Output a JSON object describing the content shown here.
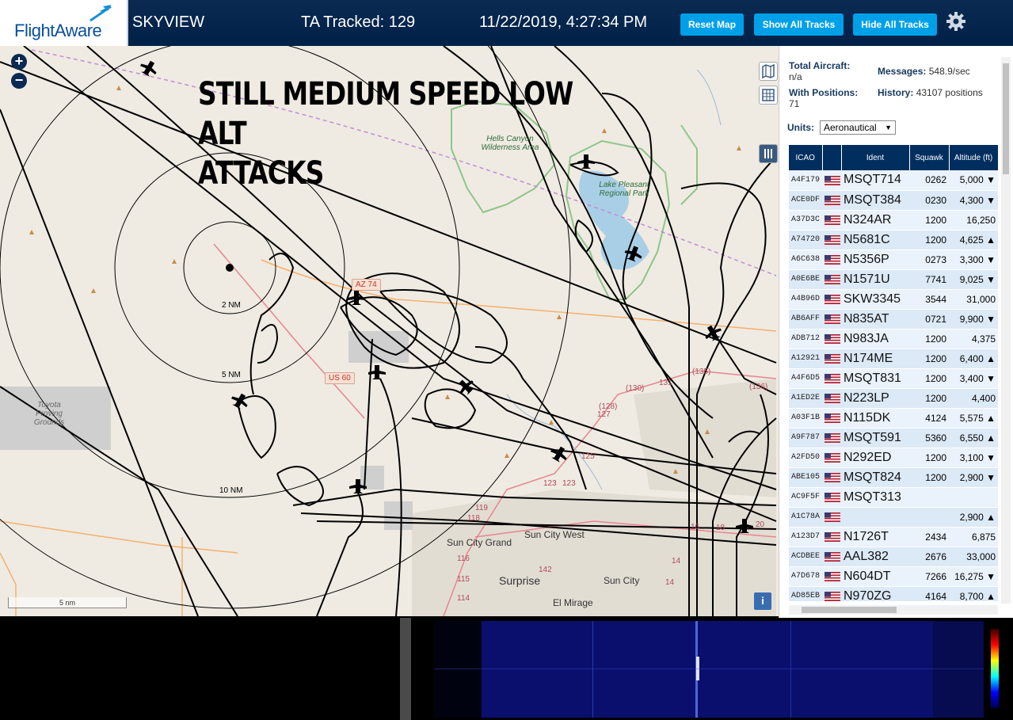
{
  "header": {
    "logo": "FlightAware",
    "app_title": "SKYVIEW",
    "ta_tracked": "TA Tracked: 129",
    "datetime": "11/22/2019, 4:27:34 PM",
    "buttons": {
      "reset": "Reset Map",
      "show_all": "Show All Tracks",
      "hide_all": "Hide All Tracks"
    },
    "settings_icon": "gear-icon",
    "accent_color": "#00a0e9"
  },
  "map": {
    "annotation_line1": "STILL MEDIUM SPEED LOW ALT",
    "annotation_line2": "ATTACKS",
    "ring_labels": [
      "2 NM",
      "5 NM",
      "10 NM"
    ],
    "towns": [
      "Sun City Grand",
      "Sun City West",
      "Surprise",
      "Sun City",
      "El Mirage"
    ],
    "park_labels": [
      "Hells Canyon Wilderness Area",
      "Lake Pleasant Regional Park",
      "Toyota Proving Grounds"
    ],
    "road_shields": [
      "AZ 74",
      "US 60"
    ],
    "route_numbers": [
      "(130)",
      "(128)",
      "127",
      "125",
      "123",
      "123",
      "119",
      "118",
      "116",
      "115",
      "114",
      "142",
      "(135)",
      "(136)",
      "131",
      "14",
      "18",
      "20",
      "16",
      "14"
    ],
    "scale_bar": "5 nm",
    "zoom_in": "+",
    "zoom_out": "−",
    "info": "i"
  },
  "panel": {
    "total_aircraft_label": "Total Aircraft:",
    "total_aircraft_value": "n/a",
    "messages_label": "Messages:",
    "messages_value": "548.9/sec",
    "with_positions_label": "With Positions:",
    "with_positions_value": "71",
    "history_label": "History:",
    "history_value": "43107 positions",
    "units_label": "Units:",
    "units_value": "Aeronautical",
    "columns": [
      "ICAO",
      "",
      "Ident",
      "Squawk",
      "Altitude (ft)"
    ],
    "rows": [
      {
        "icao": "A4F179",
        "ident": "MSQT714",
        "squawk": "0262",
        "alt": "5,000 ▼"
      },
      {
        "icao": "ACE0DF",
        "ident": "MSQT384",
        "squawk": "0230",
        "alt": "4,300 ▼"
      },
      {
        "icao": "A37D3C",
        "ident": "N324AR",
        "squawk": "1200",
        "alt": "16,250"
      },
      {
        "icao": "A74720",
        "ident": "N5681C",
        "squawk": "1200",
        "alt": "4,625 ▲"
      },
      {
        "icao": "A6C638",
        "ident": "N5356P",
        "squawk": "0273",
        "alt": "3,300 ▼"
      },
      {
        "icao": "A0E6BE",
        "ident": "N1571U",
        "squawk": "7741",
        "alt": "9,025 ▼"
      },
      {
        "icao": "A4B96D",
        "ident": "SKW3345",
        "squawk": "3544",
        "alt": "31,000"
      },
      {
        "icao": "AB6AFF",
        "ident": "N835AT",
        "squawk": "0721",
        "alt": "9,900 ▼"
      },
      {
        "icao": "ADB712",
        "ident": "N983JA",
        "squawk": "1200",
        "alt": "4,375"
      },
      {
        "icao": "A12921",
        "ident": "N174ME",
        "squawk": "1200",
        "alt": "6,400 ▲"
      },
      {
        "icao": "A4F6D5",
        "ident": "MSQT831",
        "squawk": "1200",
        "alt": "3,400 ▼"
      },
      {
        "icao": "A1ED2E",
        "ident": "N223LP",
        "squawk": "1200",
        "alt": "4,400"
      },
      {
        "icao": "A03F1B",
        "ident": "N115DK",
        "squawk": "4124",
        "alt": "5,575 ▲"
      },
      {
        "icao": "A9F787",
        "ident": "MSQT591",
        "squawk": "5360",
        "alt": "6,550 ▲"
      },
      {
        "icao": "A2FD50",
        "ident": "N292ED",
        "squawk": "1200",
        "alt": "3,100 ▼"
      },
      {
        "icao": "ABE105",
        "ident": "MSQT824",
        "squawk": "1200",
        "alt": "2,900 ▼"
      },
      {
        "icao": "AC9F5F",
        "ident": "MSQT313",
        "squawk": "",
        "alt": ""
      },
      {
        "icao": "A1C78A",
        "ident": "",
        "squawk": "",
        "alt": "2,900 ▲"
      },
      {
        "icao": "A123D7",
        "ident": "N1726T",
        "squawk": "2434",
        "alt": "6,875"
      },
      {
        "icao": "ACDBEE",
        "ident": "AAL382",
        "squawk": "2676",
        "alt": "33,000"
      },
      {
        "icao": "A7D678",
        "ident": "N604DT",
        "squawk": "7266",
        "alt": "16,275 ▼"
      },
      {
        "icao": "AD85EB",
        "ident": "N970ZG",
        "squawk": "4164",
        "alt": "8,700 ▲"
      }
    ]
  }
}
